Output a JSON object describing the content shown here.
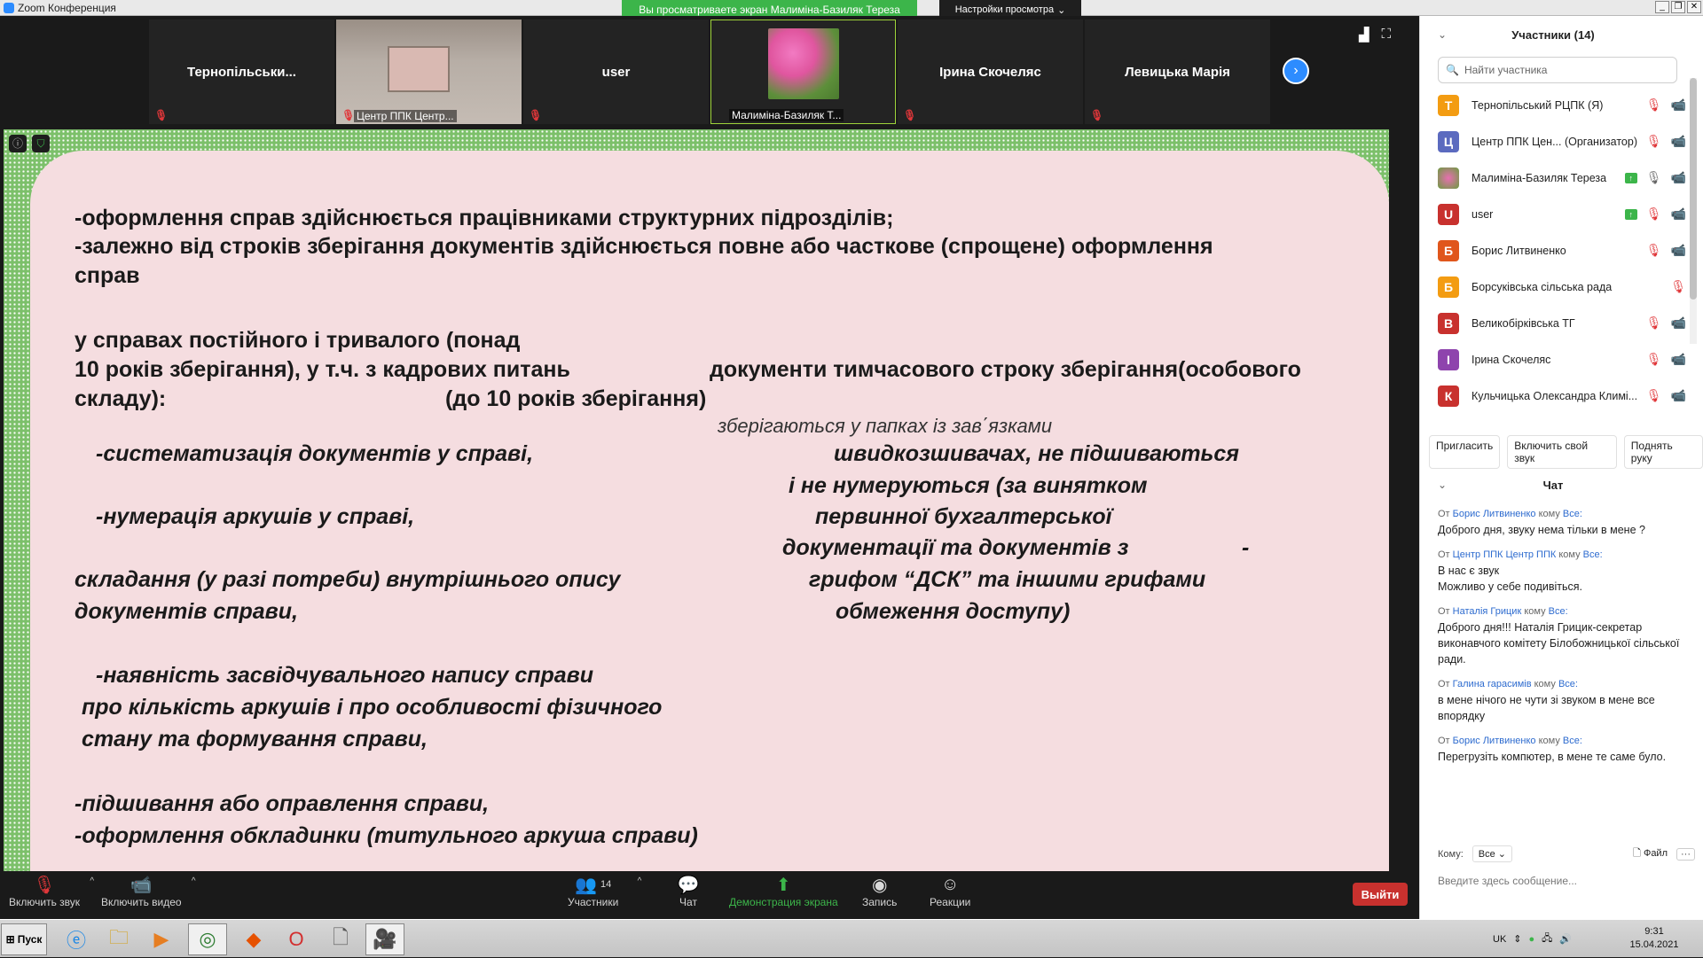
{
  "window": {
    "title": "Zoom Конференция"
  },
  "share_banner": "Вы просматриваете экран Малиміна-Базиляк Тереза",
  "view_options": "Настройки просмотра",
  "thumbnails": [
    {
      "name": "Тернопільськи...",
      "label": ""
    },
    {
      "name": "",
      "label": "Центр ППК Центр..."
    },
    {
      "name": "user",
      "label": ""
    },
    {
      "name": "",
      "label": "Малиміна-Базиляк Т..."
    },
    {
      "name": "Ірина Скочеляс",
      "label": ""
    },
    {
      "name": "Левицька Марія",
      "label": ""
    }
  ],
  "slide": {
    "l1": "-оформлення справ здійснюється працівниками структурних підрозділів;",
    "l2": "-залежно від строків зберігання документів здійснюється повне або часткове (спрощене) оформлення",
    "l3": "справ",
    "l4": "у справах постійного і тривалого (понад",
    "l5a": "10 років зберігання), у т.ч. з кадрових питань",
    "l5b": "документи тимчасового строку зберігання(особового",
    "l6a": "складу):",
    "l6b": "(до 10 років зберігання)",
    "l7": "зберігаються у папках із зав΄язками",
    "l8a": "-систематизація документів у справі,",
    "l8b": "швидкозшивачах, не підшиваються",
    "l9": "і не нумеруються (за винятком",
    "l10a": "-нумерація аркушів у справі,",
    "l10b": "первинної бухгалтерської",
    "l11a": "документації та документів з",
    "l11b": "-",
    "l12a": "складання (у разі потреби) внутрішнього опису",
    "l12b": "грифом  “ДСК” та іншими грифами",
    "l13a": "документів справи,",
    "l13b": "обмеження доступу)",
    "l14": "-наявність засвідчувального напису справи",
    "l15": "про кількість аркушів і про особливості фізичного",
    "l16": "стану та формування справи,",
    "l17": "-підшивання або оправлення справи,",
    "l18": "-оформлення обкладинки (титульного аркуша справи)"
  },
  "toolbar": {
    "audio": "Включить звук",
    "video": "Включить видео",
    "participants": "Участники",
    "participants_count": "14",
    "chat": "Чат",
    "share": "Демонстрация экрана",
    "record": "Запись",
    "reactions": "Реакции",
    "leave": "Выйти"
  },
  "panel": {
    "title": "Участники (14)",
    "search_placeholder": "Найти участника",
    "participants": [
      {
        "initial": "Т",
        "color": "#f39c12",
        "name": "Тернопільський РЦПК (Я)"
      },
      {
        "initial": "Ц",
        "color": "#5b6abf",
        "name": "Центр ППК Цен... (Организатор)"
      },
      {
        "initial": "",
        "color": "#c0508a",
        "name": "Малиміна-Базиляк Тереза"
      },
      {
        "initial": "U",
        "color": "#c8312e",
        "name": "user"
      },
      {
        "initial": "Б",
        "color": "#e0561c",
        "name": "Борис Литвиненко"
      },
      {
        "initial": "Б",
        "color": "#f39c12",
        "name": "Борсуківська сільська рада"
      },
      {
        "initial": "В",
        "color": "#c8312e",
        "name": "Великобірківська ТГ"
      },
      {
        "initial": "I",
        "color": "#8e44ad",
        "name": "Ірина Скочеляс"
      },
      {
        "initial": "К",
        "color": "#c8312e",
        "name": "Кульчицька Олександра Климі..."
      }
    ],
    "actions": [
      "Пригласить",
      "Включить свой звук",
      "Поднять руку"
    ],
    "chat_title": "Чат",
    "messages": [
      {
        "from": "Борис Литвиненко",
        "to": "Все:",
        "text": "Доброго дня, звуку нема тільки в мене ?"
      },
      {
        "from": "Центр ППК Центр ППК",
        "to": "Все:",
        "text": "В нас є звук\nМожливо у себе подивіться."
      },
      {
        "from": "Наталія Грицик",
        "to": "Все:",
        "text": "Доброго дня!!! Наталія Грицик-секретар виконавчого комітету Білобожницької сільської ради."
      },
      {
        "from": "Галина гарасимів",
        "to": "Все:",
        "text": "в мене нічого не чути зі звуком в мене все впорядку"
      },
      {
        "from": "Борис Литвиненко",
        "to": "Все:",
        "text": "Перегрузіть компютер, в мене те саме було."
      }
    ],
    "from_word": "От",
    "to_word": "кому",
    "to_label": "Кому:",
    "to_value": "Все",
    "file_label": "Файл",
    "compose_placeholder": "Введите здесь сообщение..."
  },
  "taskbar": {
    "start": "Пуск",
    "lang": "UK",
    "time": "9:31",
    "date": "15.04.2021"
  }
}
